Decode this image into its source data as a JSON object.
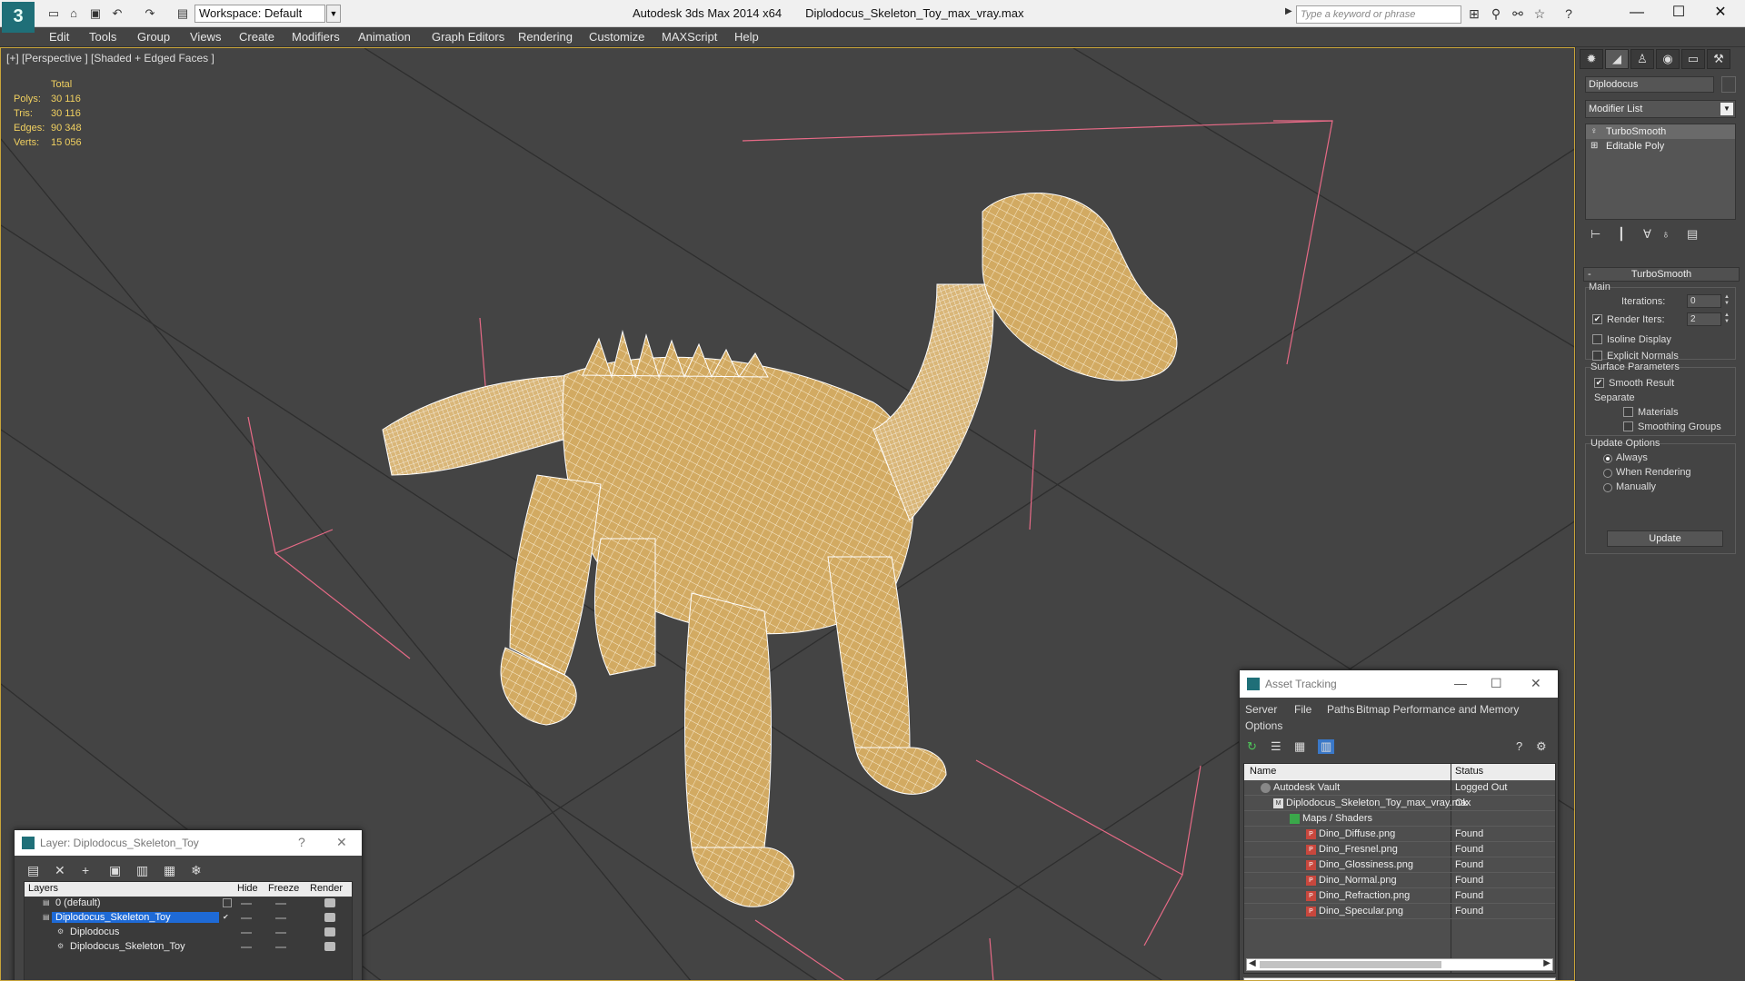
{
  "titlebar": {
    "app_logo": "3",
    "workspace": "Workspace: Default",
    "app_name": "Autodesk 3ds Max  2014 x64",
    "file_name": "Diplodocus_Skeleton_Toy_max_vray.max",
    "search_placeholder": "Type a keyword or phrase",
    "controls": {
      "minimize": "—",
      "maximize": "☐",
      "close": "✕"
    }
  },
  "menu": {
    "items": [
      "Edit",
      "Tools",
      "Group",
      "Views",
      "Create",
      "Modifiers",
      "Animation",
      "Graph Editors",
      "Rendering",
      "Customize",
      "MAXScript",
      "Help"
    ]
  },
  "viewport": {
    "label": "[+] [Perspective ] [Shaded + Edged Faces ]",
    "stats": {
      "header": "Total",
      "rows": [
        {
          "key": "Polys:",
          "value": "30 116"
        },
        {
          "key": "Tris:",
          "value": "30 116"
        },
        {
          "key": "Edges:",
          "value": "90 348"
        },
        {
          "key": "Verts:",
          "value": "15 056"
        }
      ]
    },
    "colors": {
      "background": "#444444",
      "grid": "#2e2e2e",
      "mesh": "#d2aa62",
      "wire": "#ffffff",
      "bbox": "#e66a86",
      "border": "#c9a53a"
    }
  },
  "command_panel": {
    "object_name": "Diplodocus",
    "modifier_list": "Modifier List",
    "stack": [
      "TurboSmooth",
      "Editable Poly"
    ],
    "rollout_title": "TurboSmooth",
    "main_group": "Main",
    "iterations_label": "Iterations:",
    "iterations_value": "0",
    "render_iters_label": "Render Iters:",
    "render_iters_value": "2",
    "render_iters_checked": true,
    "isoline_label": "Isoline Display",
    "explicit_normals_label": "Explicit Normals",
    "surface_group": "Surface Parameters",
    "smooth_result_label": "Smooth Result",
    "separate_label": "Separate",
    "materials_label": "Materials",
    "smoothing_groups_label": "Smoothing Groups",
    "update_group": "Update Options",
    "always_label": "Always",
    "when_rendering_label": "When Rendering",
    "manually_label": "Manually",
    "update_button": "Update"
  },
  "asset_tracking": {
    "title": "Asset Tracking",
    "menu": [
      "Server",
      "File",
      "Paths",
      "Bitmap Performance and Memory",
      "Options"
    ],
    "columns": {
      "name": "Name",
      "status": "Status"
    },
    "rows": [
      {
        "name": "Autodesk Vault",
        "status": "Logged Out",
        "indent": 1,
        "icon": "vault-icon"
      },
      {
        "name": "Diplodocus_Skeleton_Toy_max_vray.max",
        "status": "Ok",
        "indent": 2,
        "icon": "max-file-icon"
      },
      {
        "name": "Maps / Shaders",
        "status": "",
        "indent": 3,
        "icon": "maps-icon"
      },
      {
        "name": "Dino_Diffuse.png",
        "status": "Found",
        "indent": 4,
        "icon": "png-icon"
      },
      {
        "name": "Dino_Fresnel.png",
        "status": "Found",
        "indent": 4,
        "icon": "png-icon"
      },
      {
        "name": "Dino_Glossiness.png",
        "status": "Found",
        "indent": 4,
        "icon": "png-icon"
      },
      {
        "name": "Dino_Normal.png",
        "status": "Found",
        "indent": 4,
        "icon": "png-icon"
      },
      {
        "name": "Dino_Refraction.png",
        "status": "Found",
        "indent": 4,
        "icon": "png-icon"
      },
      {
        "name": "Dino_Specular.png",
        "status": "Found",
        "indent": 4,
        "icon": "png-icon"
      }
    ]
  },
  "layer_manager": {
    "title": "Layer: Diplodocus_Skeleton_Toy",
    "help": "?",
    "columns": {
      "layers": "Layers",
      "hide": "Hide",
      "freeze": "Freeze",
      "render": "Render"
    },
    "rows": [
      {
        "name": "0 (default)",
        "indent": 1,
        "selected": false
      },
      {
        "name": "Diplodocus_Skeleton_Toy",
        "indent": 1,
        "selected": true
      },
      {
        "name": "Diplodocus",
        "indent": 2,
        "selected": false
      },
      {
        "name": "Diplodocus_Skeleton_Toy",
        "indent": 2,
        "selected": false
      }
    ]
  }
}
